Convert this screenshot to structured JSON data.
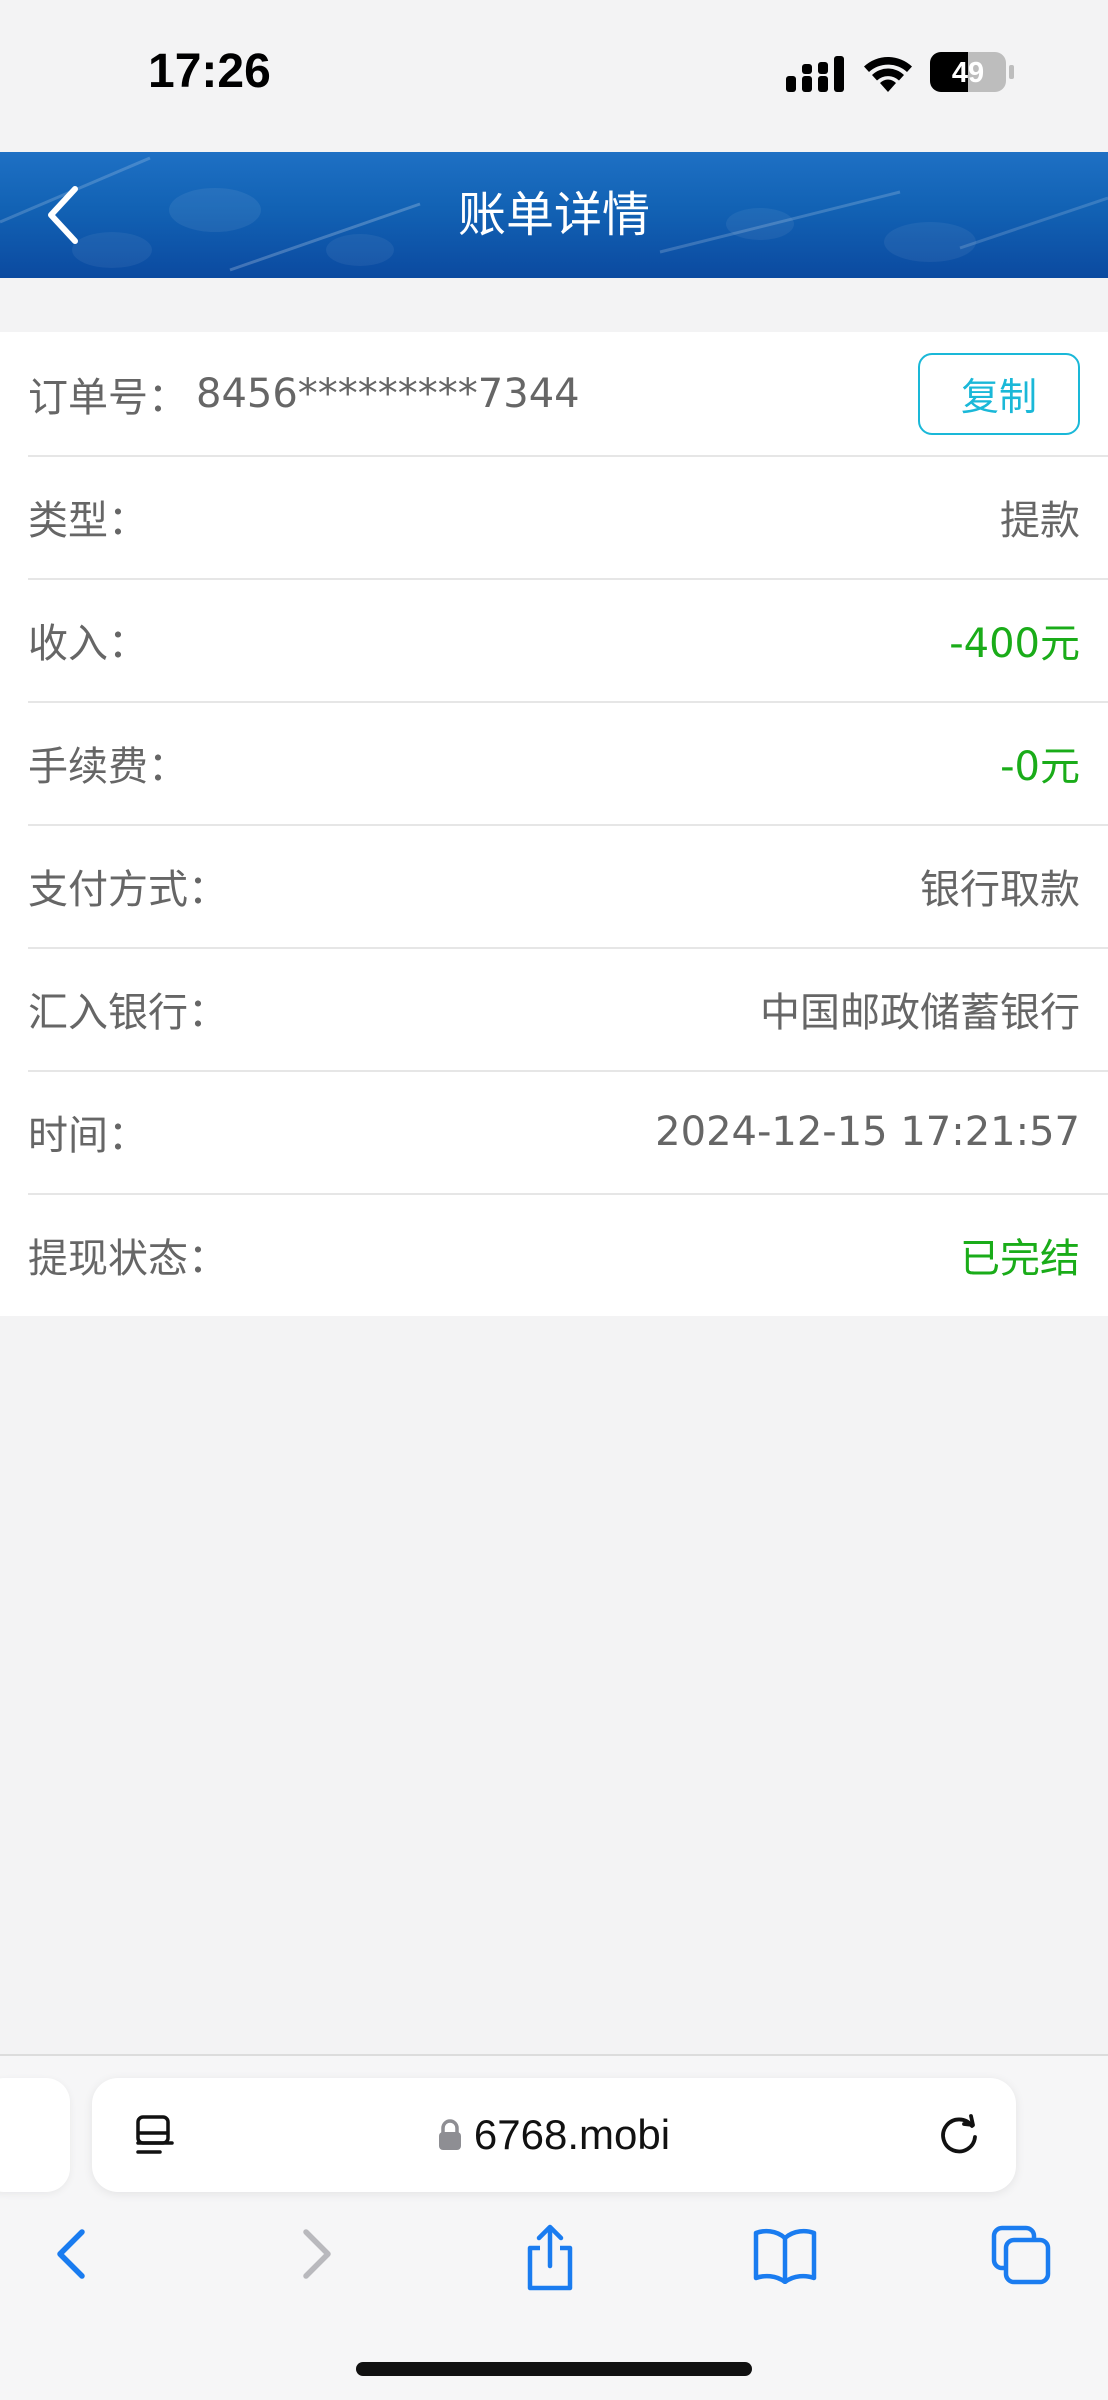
{
  "status_bar": {
    "time": "17:26",
    "battery": "49"
  },
  "header": {
    "title": "账单详情",
    "back_icon": "chevron-left-icon"
  },
  "details": {
    "order": {
      "label": "订单号：",
      "number": "8456*********7344",
      "copy_label": "复制"
    },
    "rows": [
      {
        "label": "类型：",
        "value": "提款",
        "color": "#666666"
      },
      {
        "label": "收入：",
        "value": "-400元",
        "color": "#1aac19"
      },
      {
        "label": "手续费：",
        "value": "-0元",
        "color": "#1aac19"
      },
      {
        "label": "支付方式：",
        "value": "银行取款",
        "color": "#666666"
      },
      {
        "label": "汇入银行：",
        "value": "中国邮政储蓄银行",
        "color": "#666666"
      },
      {
        "label": "时间：",
        "value": "2024-12-15 17:21:57",
        "color": "#666666"
      },
      {
        "label": "提现状态：",
        "value": "已完结",
        "color": "#1aac19"
      }
    ]
  },
  "browser": {
    "url": "6768.mobi",
    "accent": "#1a7cf0"
  }
}
